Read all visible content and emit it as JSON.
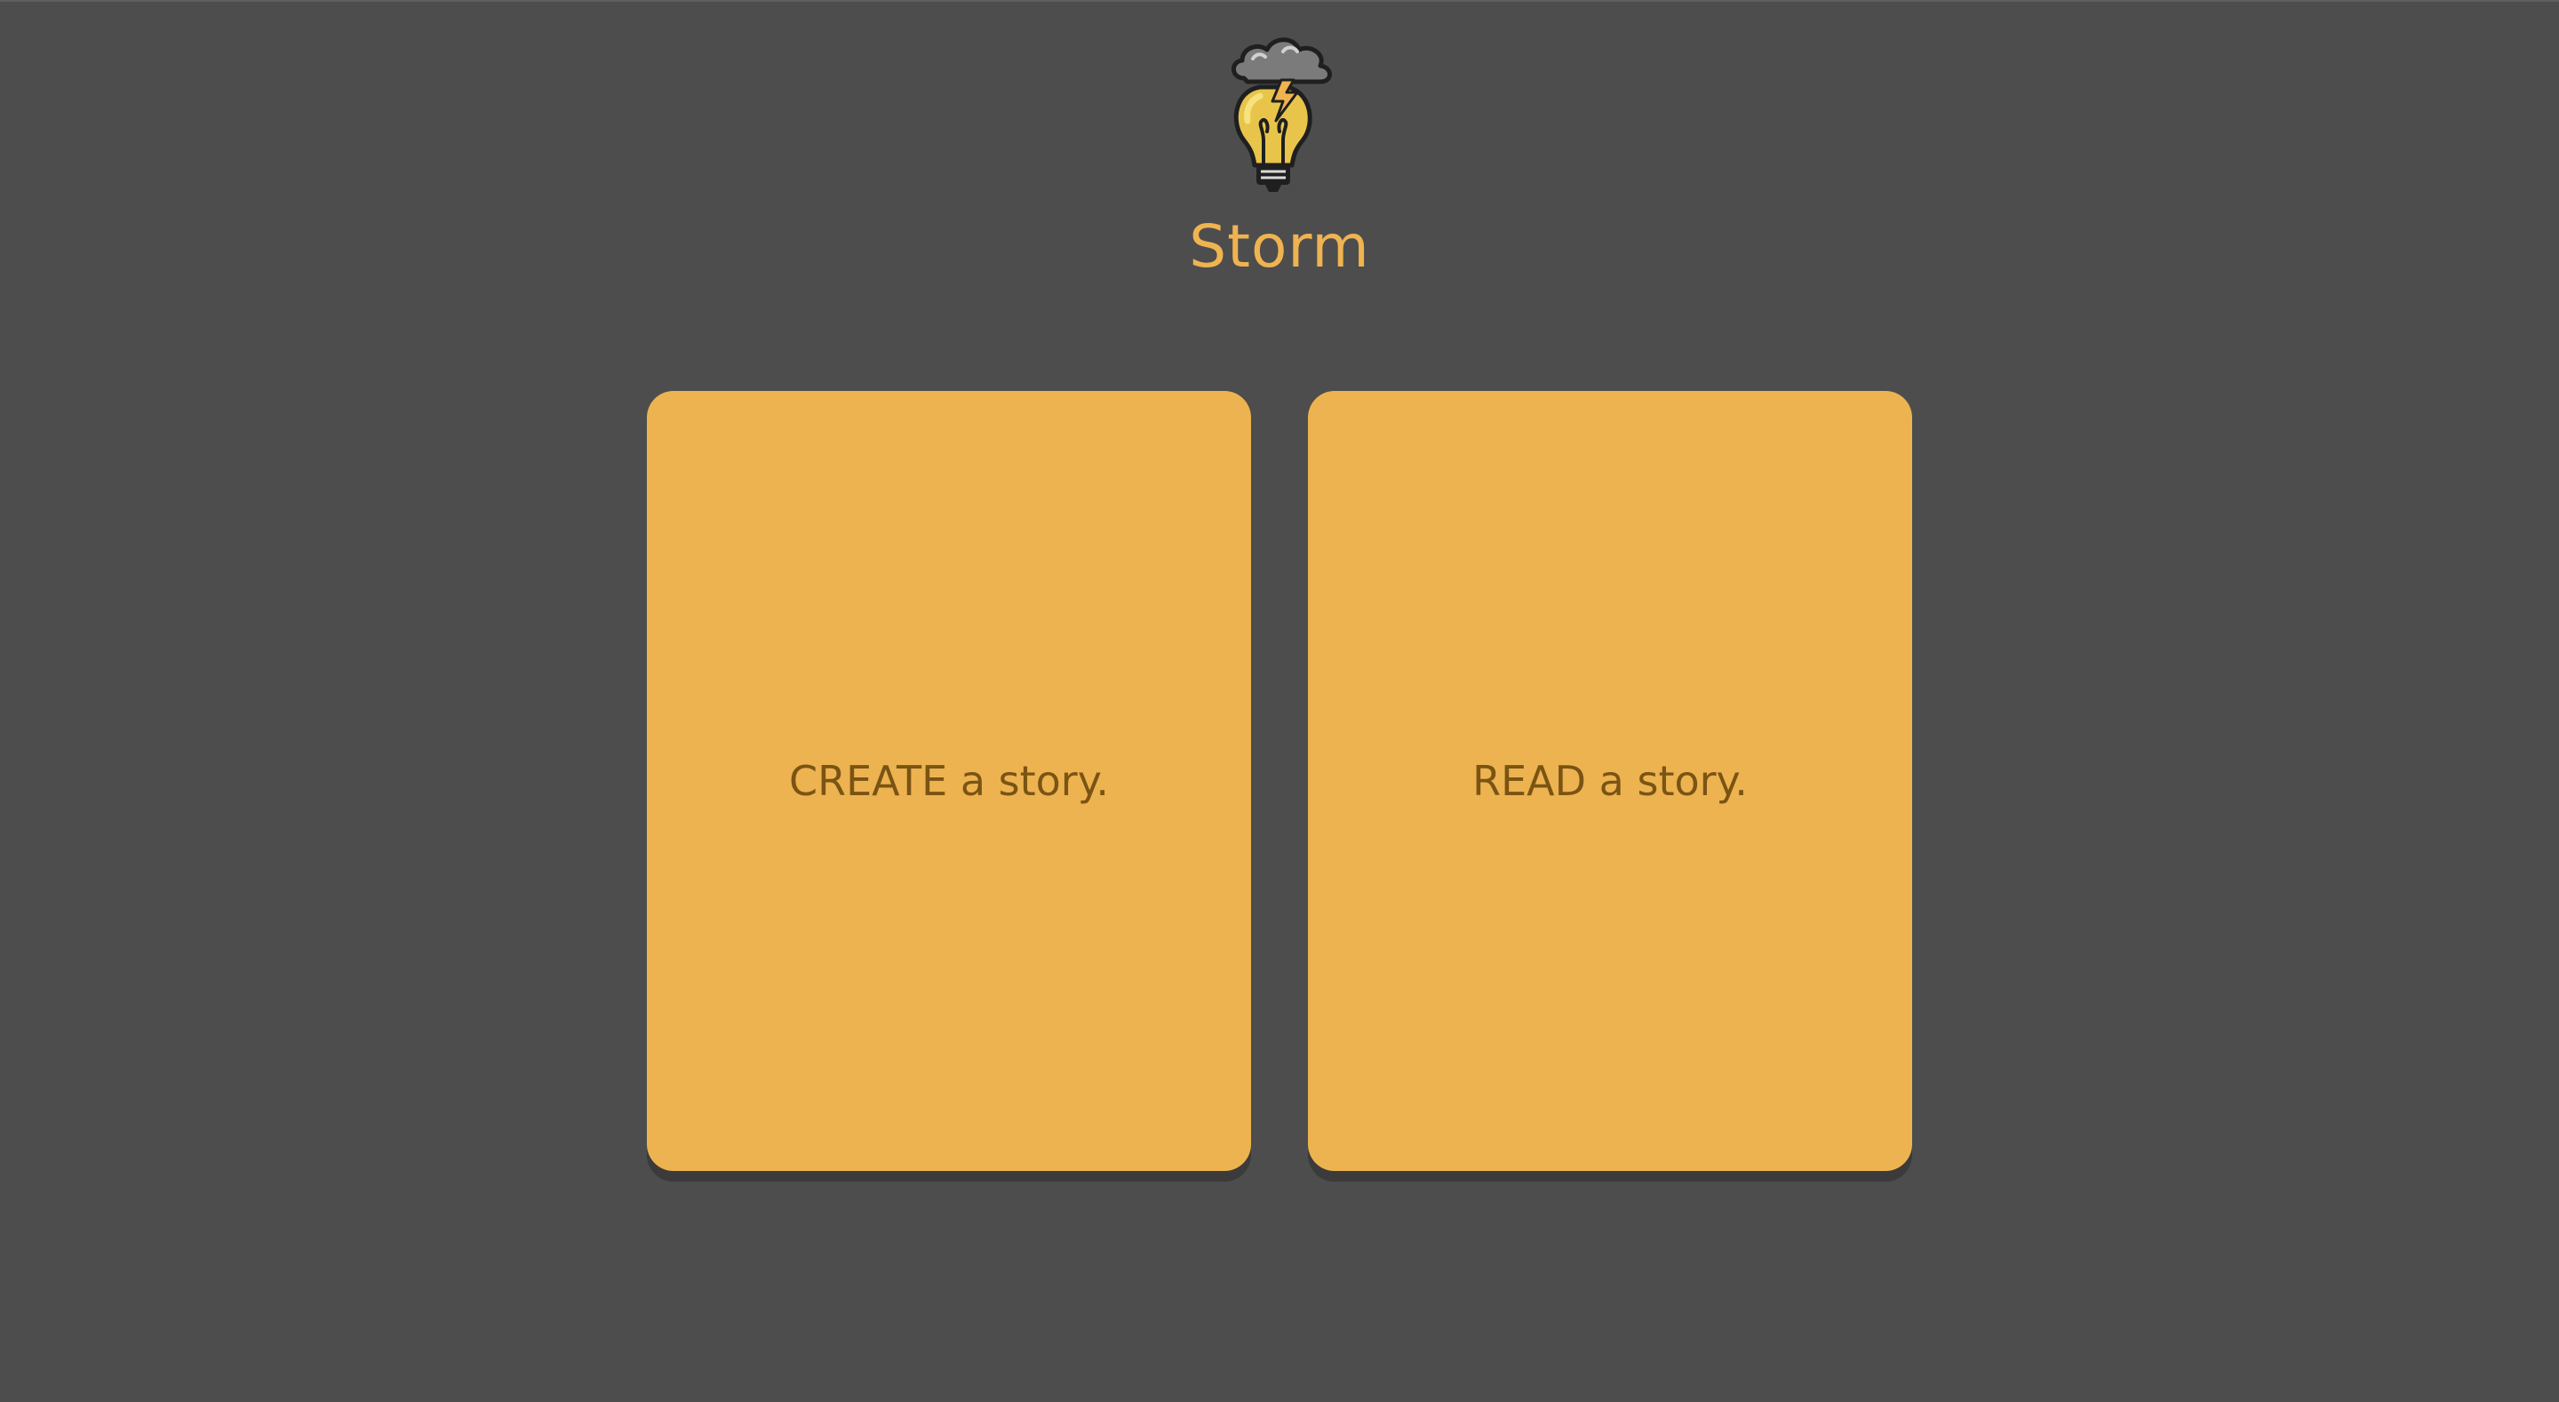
{
  "app": {
    "title": "Storm",
    "logo_icon": "storm-cloud-lightbulb-icon"
  },
  "colors": {
    "background": "#4d4d4d",
    "accent": "#edb351",
    "card_text": "#7a5413"
  },
  "cards": [
    {
      "label": "CREATE a story."
    },
    {
      "label": "READ a story."
    }
  ]
}
